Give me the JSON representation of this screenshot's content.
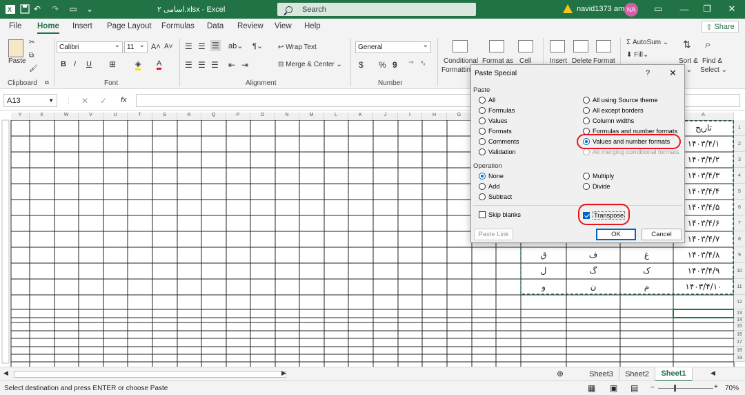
{
  "titlebar": {
    "title": "اسامی ۲.xlsx  -  Excel",
    "search_placeholder": "Search",
    "user_name": "navid1373 amz",
    "avatar_initials": "NA",
    "accent": "#217346"
  },
  "tabs": [
    "File",
    "Home",
    "Insert",
    "Page Layout",
    "Formulas",
    "Data",
    "Review",
    "View",
    "Help"
  ],
  "share_label": "Share",
  "ribbon": {
    "paste": "Paste",
    "clipboard": "Clipboard",
    "font_name": "Calibri",
    "font_size": "11",
    "font_label": "Font",
    "wrap_text": "Wrap Text",
    "merge_center": "Merge & Center",
    "alignment_label": "Alignment",
    "number_format": "General",
    "number_label": "Number",
    "conditional": "Conditional",
    "formatting": "Formattin",
    "format_as": "Format as",
    "cell": "Cell",
    "insert": "Insert",
    "delete": "Delete",
    "format": "Format",
    "autosum": "AutoSum",
    "fill": "Fill",
    "sort": "Sort &",
    "find": "Find &",
    "filter": "er",
    "select": "Select",
    "bold": "B",
    "italic": "I",
    "underline": "U",
    "currency": "$",
    "percent": "%",
    "comma": "9"
  },
  "namebox": "A13",
  "fx": "fx",
  "columns": [
    "Y",
    "X",
    "W",
    "V",
    "U",
    "T",
    "S",
    "R",
    "Q",
    "P",
    "O",
    "N",
    "M",
    "L",
    "K",
    "J",
    "I",
    "H",
    "G",
    "F",
    "E",
    "D",
    "C",
    "B",
    "A"
  ],
  "rows": [
    "1",
    "2",
    "3",
    "4",
    "5",
    "6",
    "7",
    "8",
    "9",
    "10",
    "11",
    "12",
    "13",
    "14",
    "15",
    "16",
    "17",
    "18",
    "19"
  ],
  "cells": {
    "a_header": "تاریخ",
    "a_values": [
      "۱۴۰۳/۴/۱",
      "۱۴۰۳/۴/۲",
      "۱۴۰۳/۴/۳",
      "۱۴۰۳/۴/۴",
      "۱۴۰۳/۴/۵",
      "۱۴۰۳/۴/۶",
      "۱۴۰۳/۴/۷",
      "۱۴۰۳/۴/۸",
      "۱۴۰۳/۴/۹",
      "۱۴۰۳/۴/۱۰"
    ],
    "row9": [
      "ق",
      "ف",
      "غ"
    ],
    "row10": [
      "ل",
      "گ",
      "ک"
    ],
    "row11": [
      "و",
      "ن",
      "م"
    ]
  },
  "sheets": [
    "Sheet3",
    "Sheet2",
    "Sheet1"
  ],
  "status": {
    "message": "Select destination and press ENTER or choose Paste",
    "zoom": "70%"
  },
  "dialog": {
    "title": "Paste Special",
    "help": "?",
    "paste_label": "Paste",
    "paste_left": [
      "All",
      "Formulas",
      "Values",
      "Formats",
      "Comments",
      "Validation"
    ],
    "paste_right": [
      "All using Source theme",
      "All except borders",
      "Column widths",
      "Formulas and number formats",
      "Values and number formats",
      "All merging conditional formats"
    ],
    "operation_label": "Operation",
    "op_left": [
      "None",
      "Add",
      "Subtract"
    ],
    "op_right": [
      "Multiply",
      "Divide"
    ],
    "skip_blanks": "Skip blanks",
    "transpose": "Transpose",
    "paste_link": "Paste Link",
    "ok": "OK",
    "cancel": "Cancel"
  }
}
